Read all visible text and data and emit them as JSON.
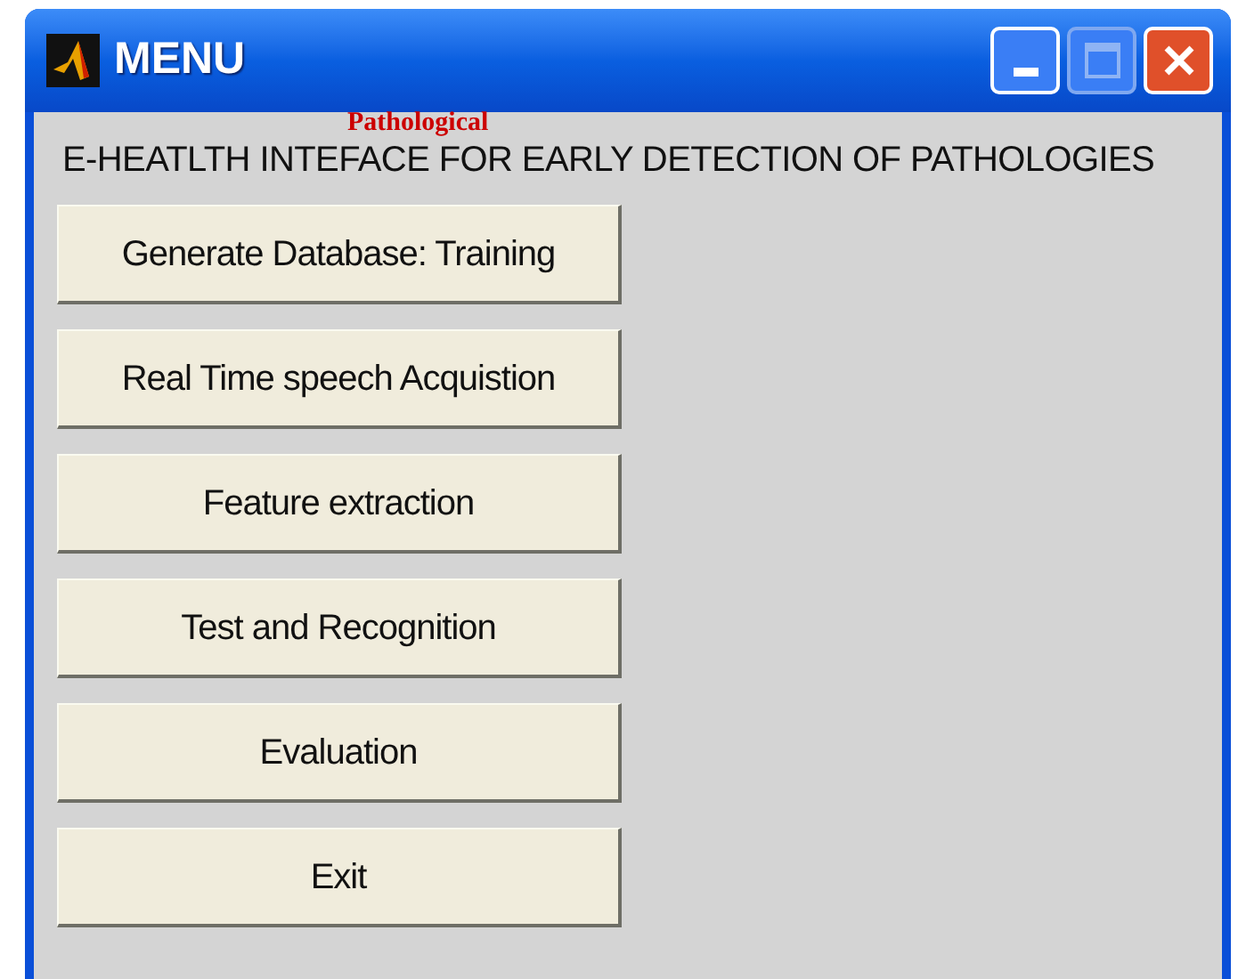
{
  "window": {
    "title": "MENU"
  },
  "annotation": "Pathological",
  "heading": "E-HEATLTH INTEFACE FOR EARLY DETECTION OF PATHOLOGIES",
  "buttons": [
    "Generate Database: Training",
    "Real Time speech Acquistion",
    "Feature extraction",
    "Test and Recognition",
    "Evaluation",
    "Exit"
  ]
}
